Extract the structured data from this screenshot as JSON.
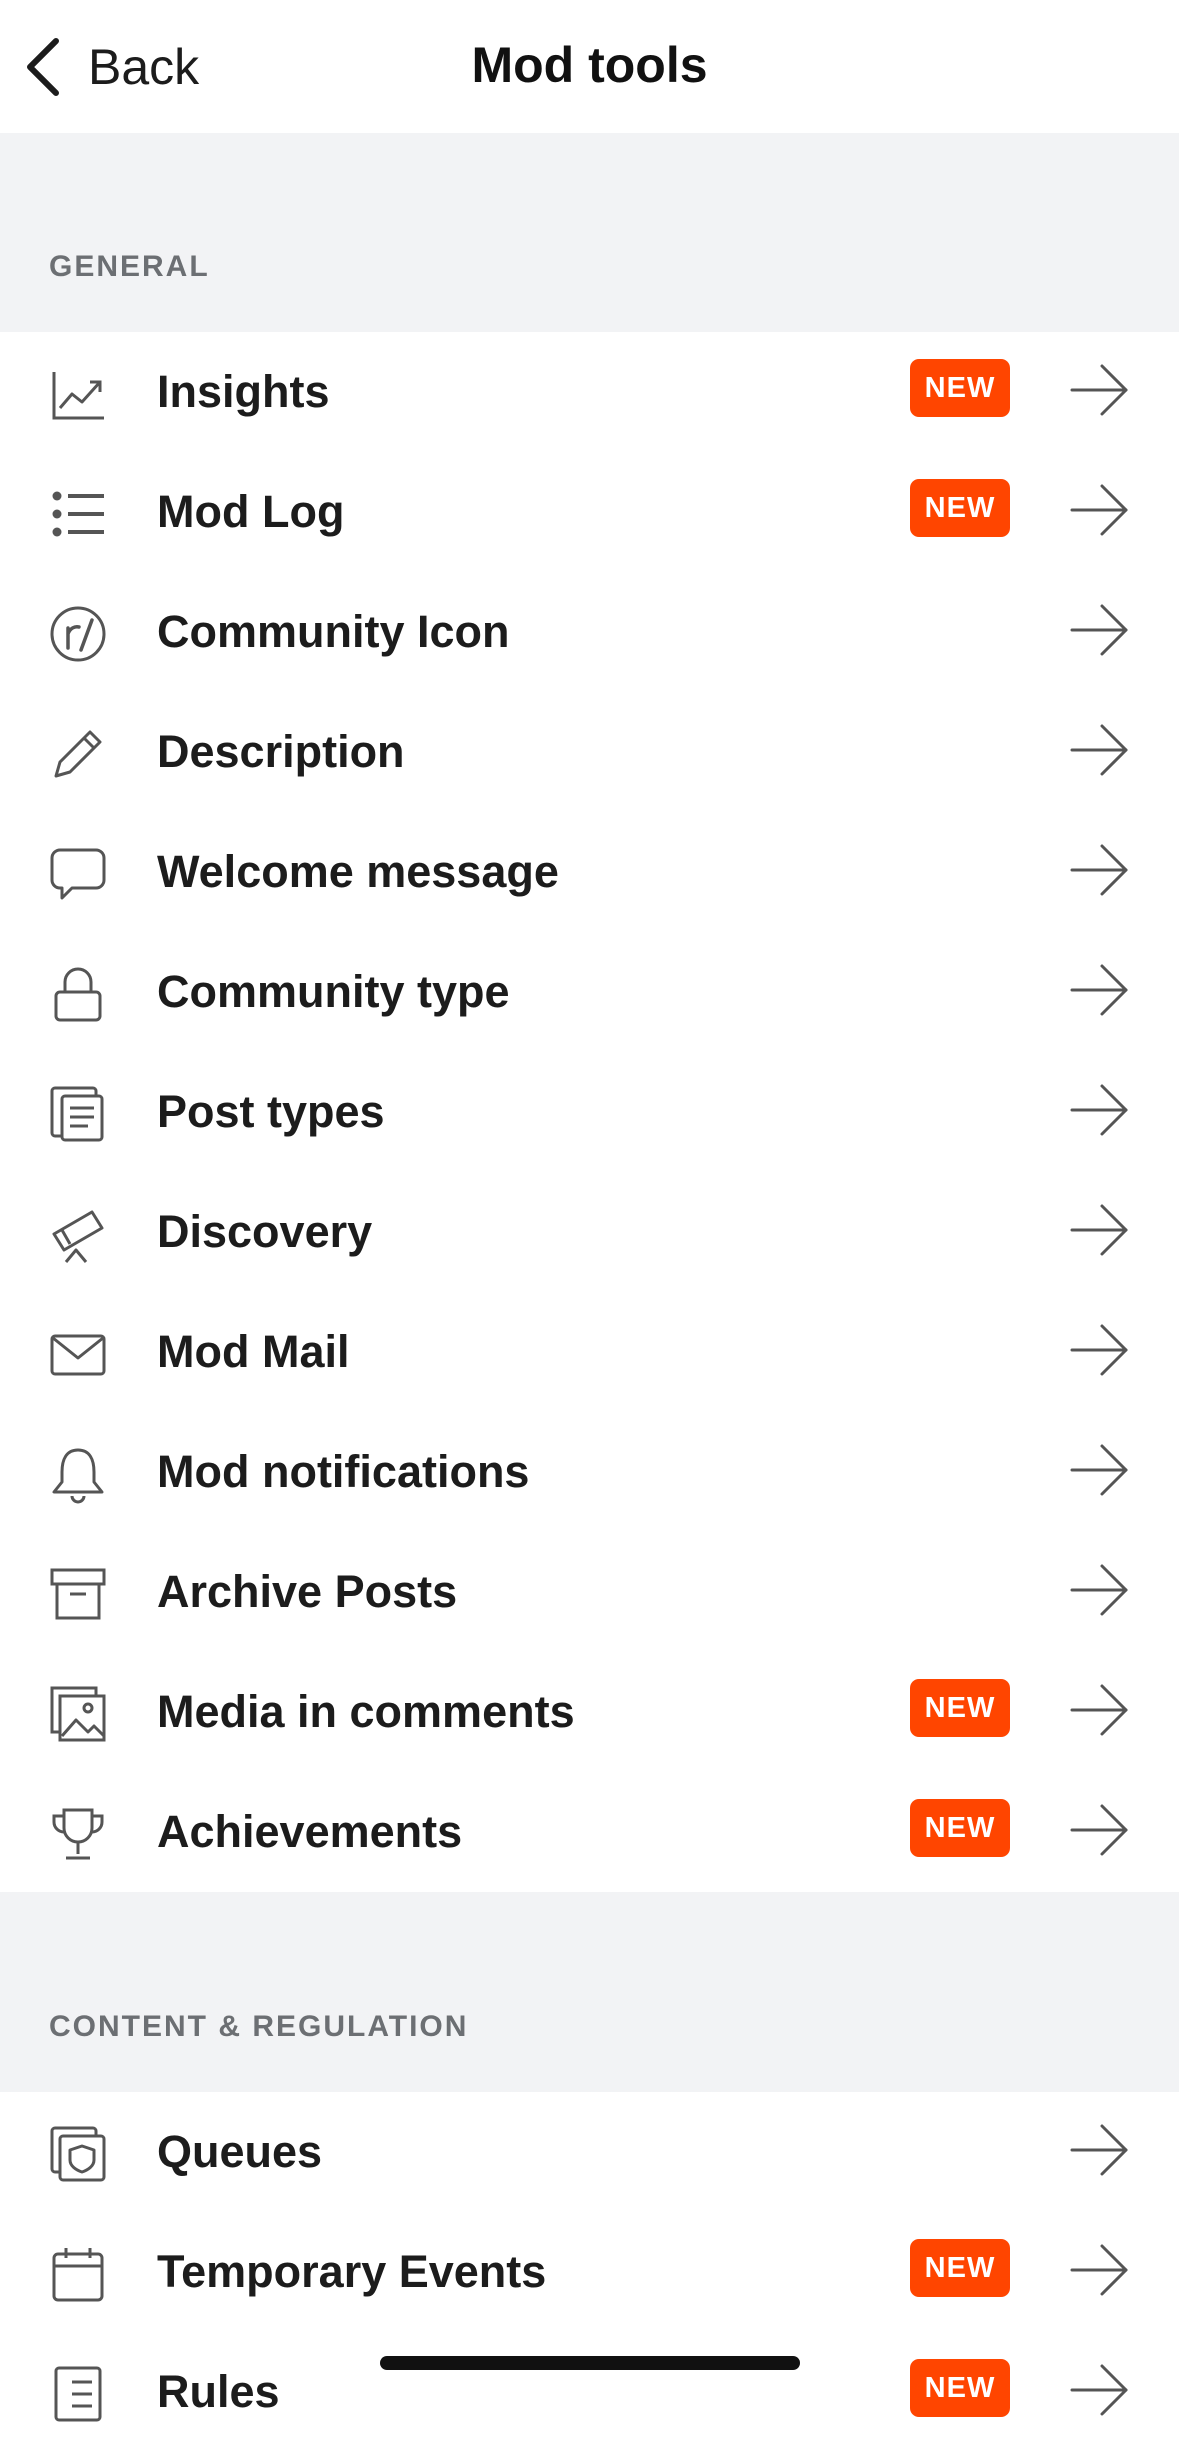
{
  "nav": {
    "back_label": "Back",
    "title": "Mod tools"
  },
  "sections": [
    {
      "header": "GENERAL",
      "items": [
        {
          "label": "Insights",
          "icon": "insights-chart-icon",
          "badge": "NEW"
        },
        {
          "label": "Mod Log",
          "icon": "list-icon",
          "badge": "NEW"
        },
        {
          "label": "Community Icon",
          "icon": "community-r-icon",
          "badge": ""
        },
        {
          "label": "Description",
          "icon": "pencil-icon",
          "badge": ""
        },
        {
          "label": "Welcome message",
          "icon": "chat-bubble-icon",
          "badge": ""
        },
        {
          "label": "Community type",
          "icon": "lock-icon",
          "badge": ""
        },
        {
          "label": "Post types",
          "icon": "post-types-icon",
          "badge": ""
        },
        {
          "label": "Discovery",
          "icon": "telescope-icon",
          "badge": ""
        },
        {
          "label": "Mod Mail",
          "icon": "envelope-icon",
          "badge": ""
        },
        {
          "label": "Mod notifications",
          "icon": "bell-icon",
          "badge": ""
        },
        {
          "label": "Archive Posts",
          "icon": "archive-box-icon",
          "badge": ""
        },
        {
          "label": "Media in comments",
          "icon": "image-icon",
          "badge": "NEW"
        },
        {
          "label": "Achievements",
          "icon": "trophy-icon",
          "badge": "NEW"
        }
      ]
    },
    {
      "header": "CONTENT & REGULATION",
      "items": [
        {
          "label": "Queues",
          "icon": "queue-shield-icon",
          "badge": ""
        },
        {
          "label": "Temporary Events",
          "icon": "calendar-icon",
          "badge": "NEW"
        },
        {
          "label": "Rules",
          "icon": "rules-list-icon",
          "badge": "NEW"
        }
      ]
    }
  ],
  "colors": {
    "badge": "#ff4500",
    "section_bg": "#f2f3f5",
    "section_text": "#6c6f73"
  }
}
